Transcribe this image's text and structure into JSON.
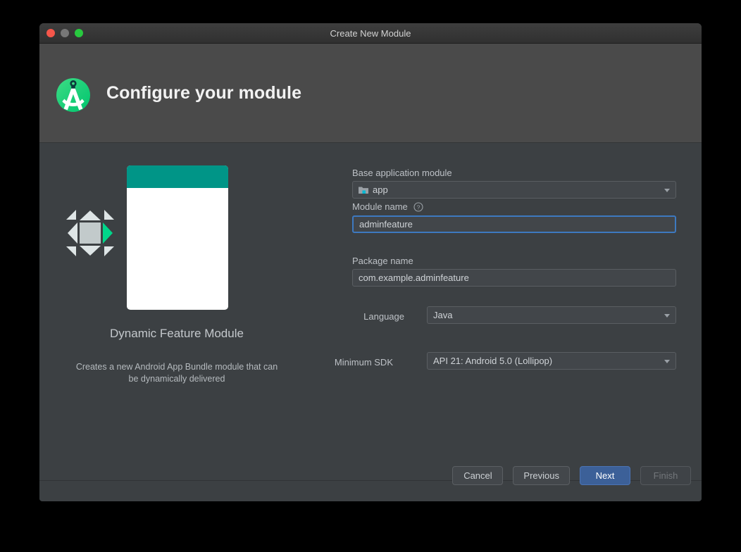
{
  "window": {
    "title": "Create New Module",
    "traffic_lights": [
      "close",
      "minimize",
      "zoom"
    ]
  },
  "header": {
    "title": "Configure your module",
    "logo_icon": "android-studio-logo"
  },
  "illustration": {
    "card_icon": "dynamic-feature-module-glyph",
    "caption_title": "Dynamic Feature Module",
    "caption_description": "Creates a new Android App Bundle module that can be dynamically delivered",
    "accent_teal": "#009587",
    "accent_green": "#00d084"
  },
  "form": {
    "base_module": {
      "label": "Base application module",
      "value": "app",
      "icon": "folder-icon"
    },
    "module_name": {
      "label": "Module name",
      "help_icon": "help-circle-icon",
      "value": "adminfeature",
      "focused": true
    },
    "package_name": {
      "label": "Package name",
      "value": "com.example.adminfeature"
    },
    "language": {
      "label": "Language",
      "value": "Java"
    },
    "minimum_sdk": {
      "label": "Minimum SDK",
      "value": "API 21: Android 5.0 (Lollipop)"
    }
  },
  "footer": {
    "cancel_label": "Cancel",
    "previous_label": "Previous",
    "next_label": "Next",
    "finish_label": "Finish",
    "primary_color": "#3c6098"
  }
}
